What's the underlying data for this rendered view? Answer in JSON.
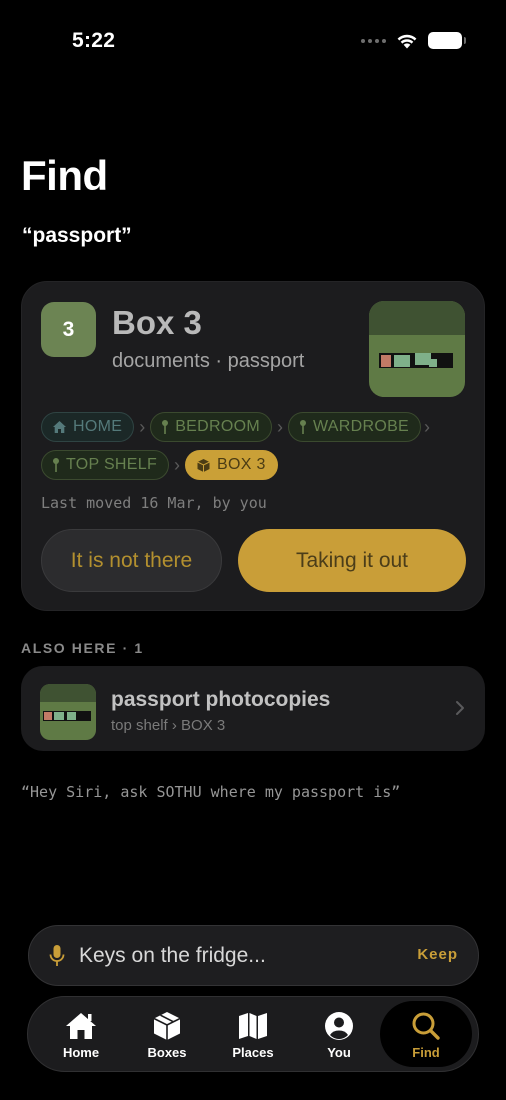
{
  "status": {
    "time": "5:22"
  },
  "page": {
    "title": "Find",
    "query": "“passport”"
  },
  "result": {
    "badge": "3",
    "title": "Box 3",
    "subtitle": "documents · passport",
    "breadcrumbs": [
      "HOME",
      "BEDROOM",
      "WARDROBE",
      "TOP SHELF",
      "BOX 3"
    ],
    "last_moved": "Last moved 16 Mar, by you",
    "not_there_label": "It is not there",
    "take_out_label": "Taking it out"
  },
  "also_here": {
    "heading": "ALSO HERE · 1",
    "items": [
      {
        "title": "passport photocopies",
        "path": "top shelf › BOX 3"
      }
    ]
  },
  "siri_hint": "“Hey Siri, ask SOTHU where my passport is”",
  "capture": {
    "placeholder": "Keys on the fridge...",
    "keep_label": "Keep"
  },
  "tabs": [
    {
      "label": "Home",
      "icon": "house-icon"
    },
    {
      "label": "Boxes",
      "icon": "box-icon"
    },
    {
      "label": "Places",
      "icon": "map-icon"
    },
    {
      "label": "You",
      "icon": "person-icon"
    },
    {
      "label": "Find",
      "icon": "search-icon",
      "active": true
    }
  ],
  "colors": {
    "accent": "#c99e38",
    "box_green": "#6c8453",
    "chip_green": "#66804f",
    "chip_teal": "#54797a"
  }
}
